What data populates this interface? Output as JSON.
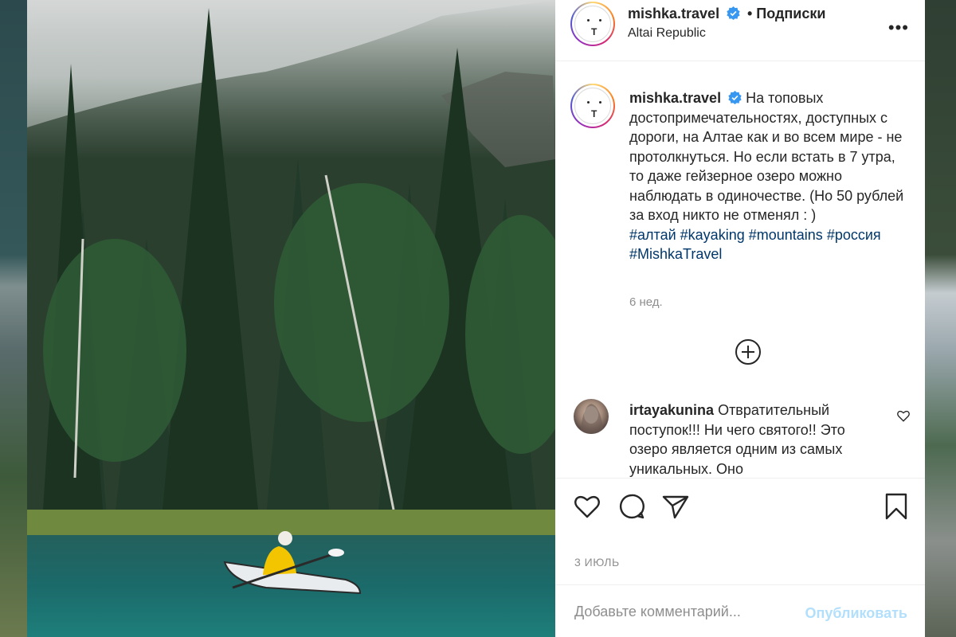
{
  "post": {
    "author": {
      "username": "mishka.travel",
      "verified": true,
      "follow_label": "• Подписки",
      "location": "Altai Republic",
      "avatar_letter": "T"
    },
    "more_icon": "more-horizontal-icon",
    "caption": {
      "username": "mishka.travel",
      "text": "На топовых достопримечательностях, доступных с дороги, на Алтае как и во всем мире - не протолкнуться. Но если встать в 7 утра, то даже гейзерное озеро можно наблюдать в одиночестве. (Но 50 рублей за вход никто не отменял : )",
      "hashtags": [
        "#алтай",
        "#kayaking",
        "#mountains",
        "#россия",
        "#MishkaTravel"
      ],
      "time_ago": "6 нед."
    },
    "load_more_icon": "plus-circle-icon",
    "comments": [
      {
        "username": "irtayakunina",
        "text": "Отвратительный поступок!!! Ни чего святого!! Это озеро является одним из самых уникальных. Оно"
      }
    ],
    "actions": {
      "like_icon": "heart-icon",
      "comment_icon": "comment-icon",
      "share_icon": "paper-plane-icon",
      "save_icon": "bookmark-icon"
    },
    "date": "3 ИЮЛЬ",
    "add_comment": {
      "placeholder": "Добавьте комментарий...",
      "publish_label": "Опубликовать"
    }
  },
  "colors": {
    "text": "#262626",
    "secondary": "#8e8e8e",
    "hashtag": "#00376b",
    "publish_disabled": "#b2dffc",
    "verified": "#3897f0"
  }
}
